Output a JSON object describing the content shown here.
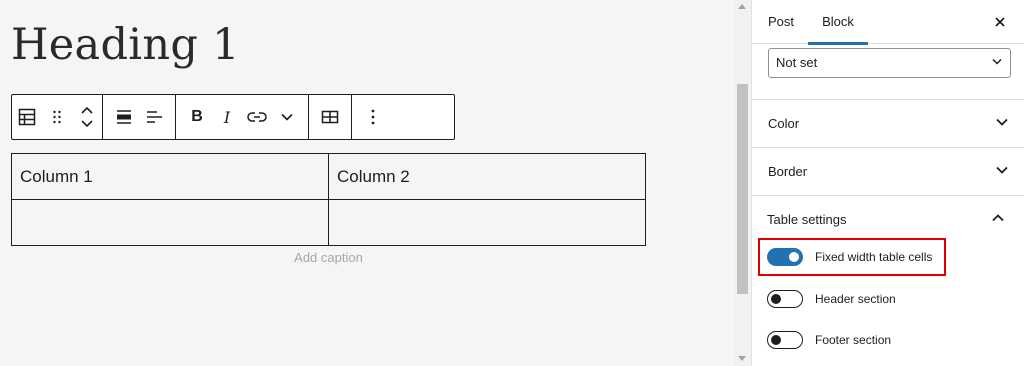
{
  "editor": {
    "heading": "Heading 1",
    "table": {
      "rows": [
        [
          "Column 1",
          "Column 2"
        ],
        [
          "",
          ""
        ]
      ],
      "caption_placeholder": "Add caption"
    }
  },
  "toolbar": {
    "icons": [
      "table-icon",
      "drag-handle-icon",
      "move-up-down-icon",
      "align-wide-icon",
      "text-align-left-icon",
      "bold-icon",
      "italic-icon",
      "link-icon",
      "chevron-down-icon",
      "edit-table-icon",
      "more-options-icon"
    ],
    "bold_label": "B",
    "italic_label": "I"
  },
  "sidebar": {
    "tabs": [
      {
        "label": "Post",
        "active": false
      },
      {
        "label": "Block",
        "active": true
      }
    ],
    "select_value": "Not set",
    "panels": [
      {
        "title": "Color"
      },
      {
        "title": "Border"
      }
    ],
    "table_settings": {
      "title": "Table settings",
      "toggles": [
        {
          "label": "Fixed width table cells",
          "on": true
        },
        {
          "label": "Header section",
          "on": false
        },
        {
          "label": "Footer section",
          "on": false
        }
      ]
    }
  },
  "colors": {
    "accent": "#2271b1",
    "highlight": "#e00000"
  }
}
